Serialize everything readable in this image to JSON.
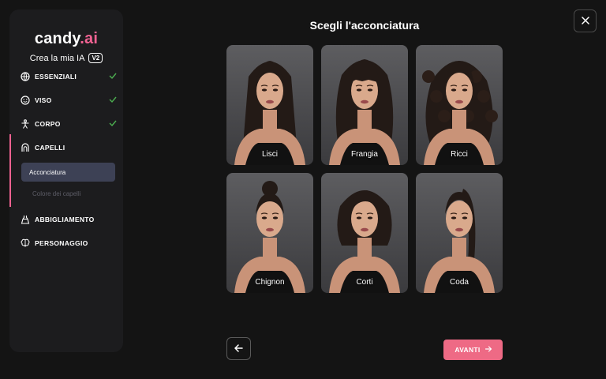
{
  "brand": {
    "name_main": "candy",
    "name_dot": ".",
    "name_accent": "ai",
    "accent_color": "#f06292"
  },
  "sidebar": {
    "subtitle": "Crea la mia IA",
    "version_badge": "V2",
    "items": [
      {
        "label": "ESSENZIALI",
        "icon": "globe-icon",
        "done": true
      },
      {
        "label": "VISO",
        "icon": "smiley-icon",
        "done": true
      },
      {
        "label": "CORPO",
        "icon": "person-icon",
        "done": true
      },
      {
        "label": "CAPELLI",
        "icon": "hair-icon",
        "done": false,
        "active": true
      },
      {
        "label": "ABBIGLIAMENTO",
        "icon": "dress-icon",
        "done": false
      },
      {
        "label": "PERSONAGGIO",
        "icon": "brain-icon",
        "done": false
      }
    ],
    "sub_items": [
      {
        "label": "Acconciatura",
        "active": true
      },
      {
        "label": "Colore dei capelli",
        "active": false
      }
    ]
  },
  "main": {
    "title": "Scegli l'acconciatura",
    "options": [
      {
        "label": "Lisci",
        "hair": "straight"
      },
      {
        "label": "Frangia",
        "hair": "bangs"
      },
      {
        "label": "Ricci",
        "hair": "curly"
      },
      {
        "label": "Chignon",
        "hair": "bun"
      },
      {
        "label": "Corti",
        "hair": "short"
      },
      {
        "label": "Coda",
        "hair": "ponytail"
      }
    ]
  },
  "footer": {
    "next_label": "AVANTI",
    "back_icon": "arrow-left-icon",
    "next_icon": "arrow-right-icon"
  },
  "colors": {
    "background": "#141414",
    "sidebar": "#1c1c1e",
    "active_sub": "#3d4155",
    "primary": "#ee6a85",
    "check": "#4caf50"
  }
}
